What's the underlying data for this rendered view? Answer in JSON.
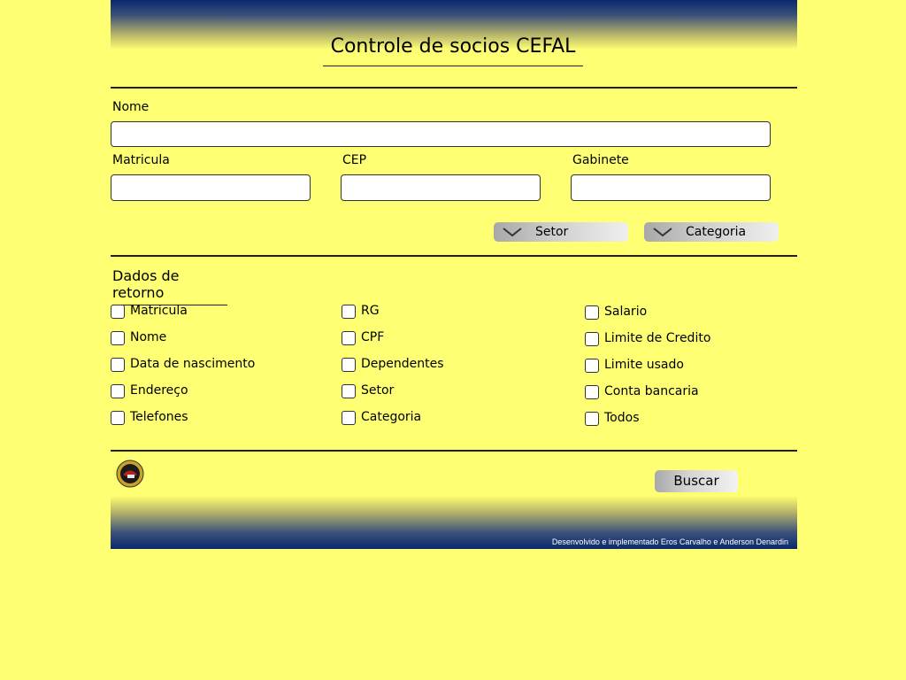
{
  "header": {
    "title": "Controle de socios CEFAL"
  },
  "form": {
    "nome_label": "Nome",
    "nome_value": "",
    "matricula_label": "Matricula",
    "matricula_value": "",
    "cep_label": "CEP",
    "cep_value": "",
    "gabinete_label": "Gabinete",
    "gabinete_value": "",
    "setor_dropdown": "Setor",
    "categoria_dropdown": "Categoria"
  },
  "dados": {
    "title": "Dados de retorno",
    "col1": [
      "Matricula",
      "Nome",
      "Data de nascimento",
      "Endereço",
      "Telefones"
    ],
    "col2": [
      "RG",
      "CPF",
      "Dependentes",
      "Setor",
      "Categoria"
    ],
    "col3": [
      "Salario",
      "Limite de Credito",
      "Limite usado",
      "Conta bancaria",
      "Todos"
    ]
  },
  "actions": {
    "search_label": "Buscar"
  },
  "footer": {
    "credits": "Desenvolvido e implementado Eros Carvalho e Anderson Denardin"
  },
  "colors": {
    "background": "#ffff73",
    "band_dark": "#0a2a6e"
  }
}
